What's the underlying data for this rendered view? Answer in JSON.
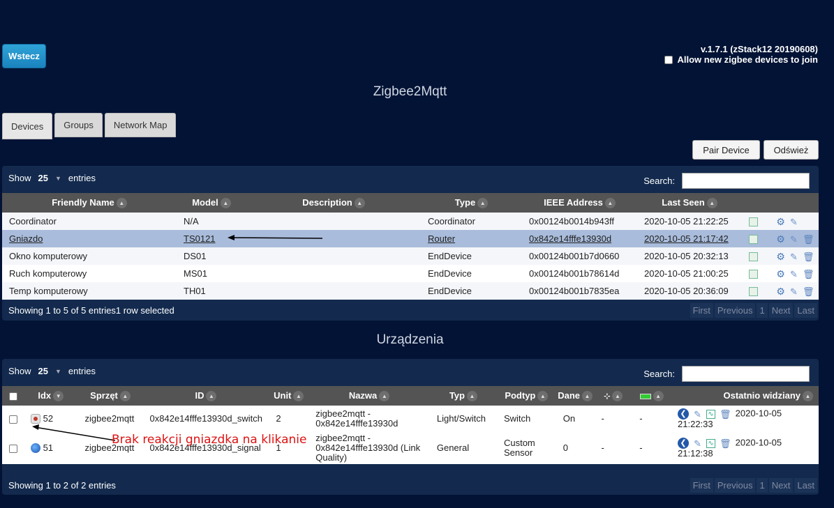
{
  "header": {
    "back_label": "Wstecz",
    "version": "v.1.7.1 (zStack12 20190608)",
    "allow_join_label": "Allow new zigbee devices to join"
  },
  "zigbee": {
    "title": "Zigbee2Mqtt",
    "tabs": [
      {
        "label": "Devices"
      },
      {
        "label": "Groups"
      },
      {
        "label": "Network Map"
      }
    ],
    "pair_label": "Pair Device",
    "refresh_label": "Odśwież",
    "show_label": "Show",
    "entries_value": "25",
    "entries_label": "entries",
    "search_label": "Search:",
    "columns": [
      "Friendly Name",
      "Model",
      "Description",
      "Type",
      "IEEE Address",
      "Last Seen"
    ],
    "rows": [
      {
        "name": "Coordinator",
        "model": "N/A",
        "desc": "",
        "type": "Coordinator",
        "ieee": "0x00124b0014b943ff",
        "seen": "2020-10-05 21:22:25"
      },
      {
        "name": "Gniazdo",
        "model": "TS0121",
        "desc": "",
        "type": "Router",
        "ieee": "0x842e14fffe13930d",
        "seen": "2020-10-05 21:17:42"
      },
      {
        "name": "Okno komputerowy",
        "model": "DS01",
        "desc": "",
        "type": "EndDevice",
        "ieee": "0x00124b001b7d0660",
        "seen": "2020-10-05 20:32:13"
      },
      {
        "name": "Ruch komputerowy",
        "model": "MS01",
        "desc": "",
        "type": "EndDevice",
        "ieee": "0x00124b001b78614d",
        "seen": "2020-10-05 21:00:25"
      },
      {
        "name": "Temp komputerowy",
        "model": "TH01",
        "desc": "",
        "type": "EndDevice",
        "ieee": "0x00124b001b7835ea",
        "seen": "2020-10-05 20:36:09"
      }
    ],
    "showing": "Showing 1 to 5 of 5 entries1 row selected",
    "pager": [
      "First",
      "Previous",
      "1",
      "Next",
      "Last"
    ]
  },
  "devices": {
    "title": "Urządzenia",
    "show_label": "Show",
    "entries_value": "25",
    "entries_label": "entries",
    "search_label": "Search:",
    "columns": [
      "Idx",
      "Sprzęt",
      "ID",
      "Unit",
      "Nazwa",
      "Typ",
      "Podtyp",
      "Dane",
      "Ostatnio widziany"
    ],
    "rows": [
      {
        "idx": "52",
        "hw": "zigbee2mqtt",
        "id": "0x842e14fffe13930d_switch",
        "unit": "2",
        "name": "zigbee2mqtt - 0x842e14fffe13930d",
        "typ": "Light/Switch",
        "sub": "Switch",
        "data": "On",
        "sig": "-",
        "bat": "-",
        "seen": "2020-10-05 21:22:33"
      },
      {
        "idx": "51",
        "hw": "zigbee2mqtt",
        "id": "0x842e14fffe13930d_signal",
        "unit": "1",
        "name": "zigbee2mqtt - 0x842e14fffe13930d (Link Quality)",
        "typ": "General",
        "sub": "Custom Sensor",
        "data": "0",
        "sig": "-",
        "bat": "-",
        "seen": "2020-10-05 21:12:38"
      }
    ],
    "showing": "Showing 1 to 2 of 2 entries",
    "pager": [
      "First",
      "Previous",
      "1",
      "Next",
      "Last"
    ]
  },
  "annotation": {
    "text": "Brak reakcji gniazdka na klikanie",
    "color": "#dd1111"
  }
}
